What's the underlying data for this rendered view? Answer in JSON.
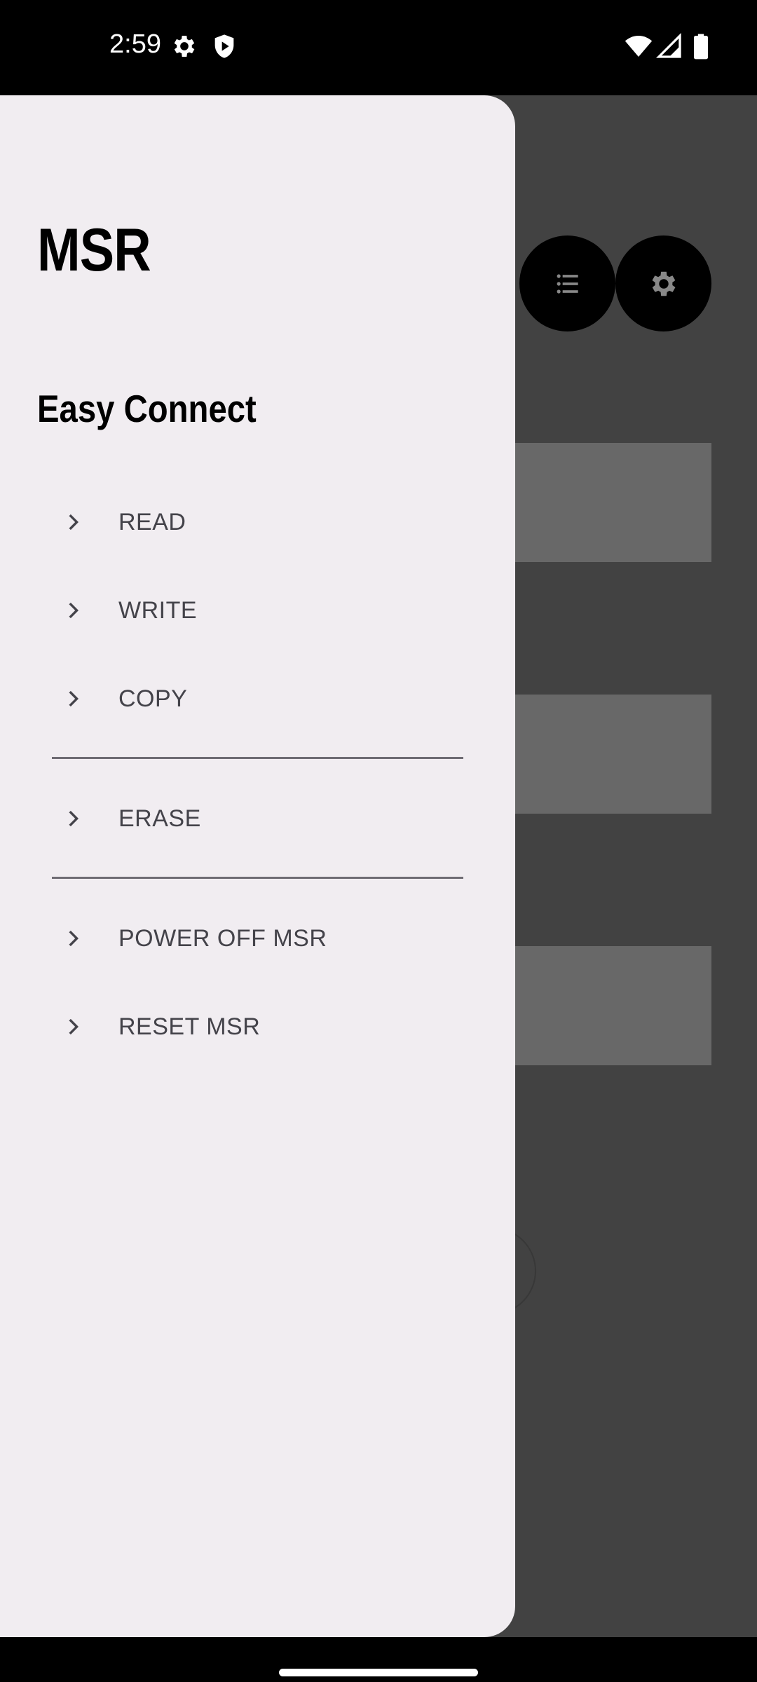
{
  "status_bar": {
    "time": "2:59",
    "left_icons": [
      "gear-icon",
      "shield-play-icon"
    ],
    "right_icons": [
      "wifi-icon",
      "cellular-signal-icon",
      "battery-icon"
    ]
  },
  "background": {
    "fab_buttons": [
      "list-icon",
      "gear-icon"
    ]
  },
  "drawer": {
    "title": "MSR",
    "subtitle": "Easy Connect",
    "items": [
      {
        "label": "READ",
        "icon": "chevron-right-icon"
      },
      {
        "label": "WRITE",
        "icon": "chevron-right-icon"
      },
      {
        "label": "COPY",
        "icon": "chevron-right-icon"
      },
      {
        "label": "ERASE",
        "icon": "chevron-right-icon"
      },
      {
        "label": "POWER OFF MSR",
        "icon": "chevron-right-icon"
      },
      {
        "label": "RESET MSR",
        "icon": "chevron-right-icon"
      }
    ]
  },
  "colors": {
    "drawer_bg": "#f1edf1",
    "scrim_bg": "#424242",
    "menu_text": "#44434a",
    "divider": "#6f6c73"
  }
}
